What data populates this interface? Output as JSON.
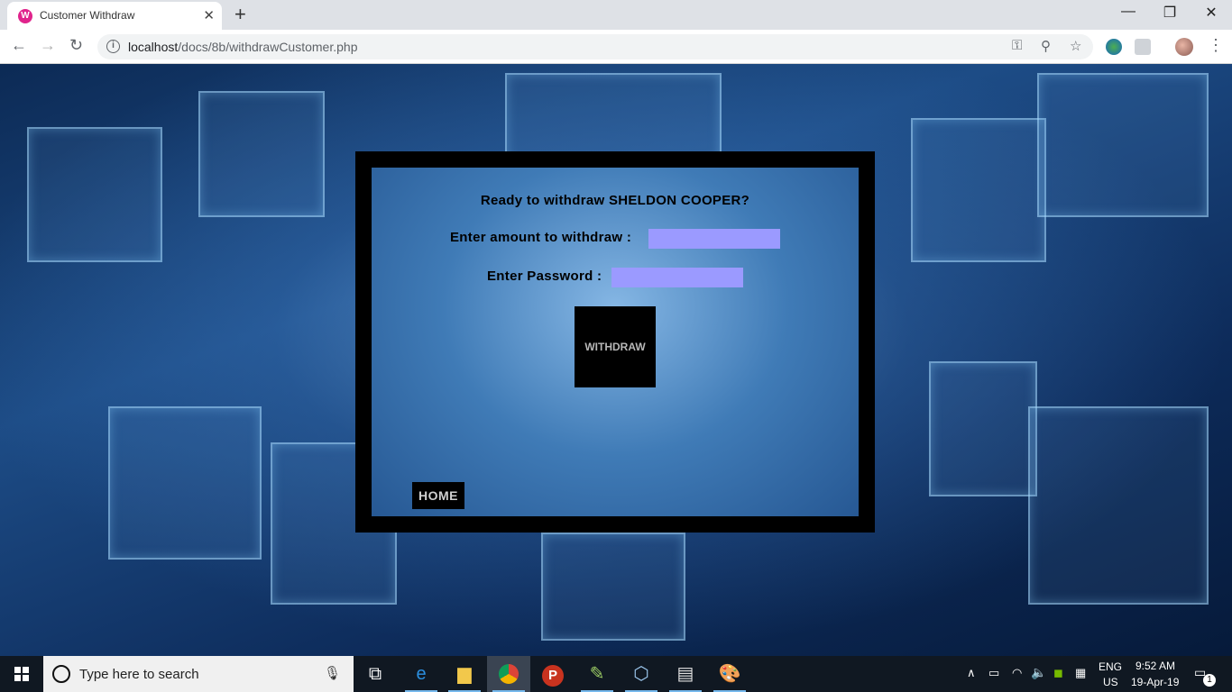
{
  "browser": {
    "tab_title": "Customer Withdraw",
    "tab_close": "✕",
    "new_tab": "+",
    "url_host": "localhost",
    "url_path": "/docs/8b/withdrawCustomer.php",
    "window_controls": {
      "minimize": "—",
      "maximize": "❐",
      "close": "✕"
    },
    "nav": {
      "back": "←",
      "forward": "→",
      "reload": "↻",
      "menu": "⋮"
    }
  },
  "form": {
    "title": "Ready to withdraw SHELDON COOPER?",
    "amount_label": "Enter amount to withdraw :",
    "amount_value": "",
    "password_label": "Enter Password :",
    "password_value": "",
    "withdraw_button": "WITHDRAW",
    "home_button": "HOME",
    "field_color": "#9b9aff"
  },
  "taskbar": {
    "search_placeholder": "Type here to search",
    "apps": [
      "task-view",
      "edge",
      "file-explorer",
      "chrome",
      "powerpoint-like",
      "notepad-plus",
      "virtualbox",
      "app-window",
      "paint"
    ],
    "lang_top": "ENG",
    "lang_bottom": "US",
    "time": "9:52 AM",
    "date": "19-Apr-19",
    "notifications": "1"
  }
}
